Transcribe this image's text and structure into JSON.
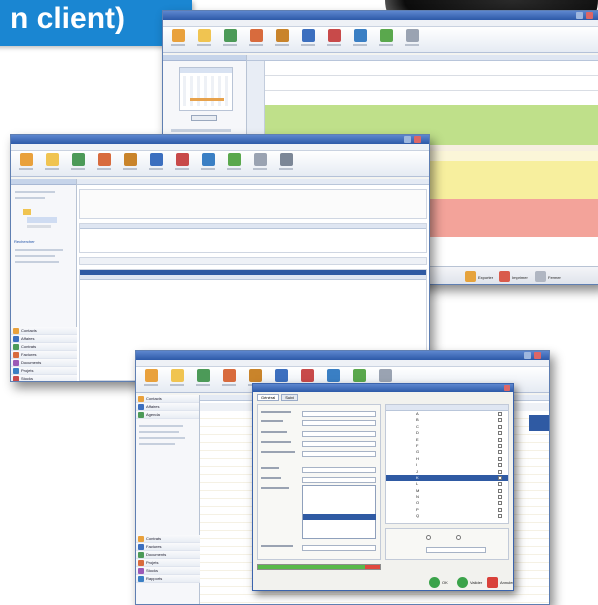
{
  "banner": {
    "title": "n client)"
  },
  "colors": {
    "banner_blue": "#1a86d2",
    "title_bar": "#2d5aa8",
    "green_band": "#bfe08a",
    "yellow_band": "#f7ef9e",
    "red_band": "#f3a39a",
    "progress_green": "#58b94a",
    "progress_red": "#e0483e"
  },
  "back_window": {
    "icons": [
      "calendar-icon",
      "folder-icon",
      "people-icon",
      "user-icon",
      "chart-icon",
      "pen-icon",
      "car-icon",
      "tools-icon",
      "upload-icon",
      "document-icon"
    ],
    "footer_buttons": [
      "Exporter",
      "Imprimer",
      "Fermer"
    ]
  },
  "middle_window": {
    "left_labels": [
      "Rechercher",
      "Contacts",
      "Ventes",
      "Agenda"
    ],
    "nav_items": [
      "Contacts",
      "Affaires",
      "Contrats",
      "Factures",
      "Documents",
      "Projets",
      "Stocks",
      "Rapports"
    ],
    "icons": [
      "calendar-icon",
      "folder-icon",
      "people-icon",
      "user-icon",
      "chart-icon",
      "pen-icon",
      "car-icon",
      "tools-icon",
      "upload-icon",
      "document-icon",
      "gear-icon"
    ]
  },
  "front_window": {
    "icons": [
      "calendar-icon",
      "folder-icon",
      "people-icon",
      "user-icon",
      "chart-icon",
      "pen-icon",
      "car-icon",
      "tools-icon",
      "upload-icon",
      "document-icon"
    ],
    "nav_items": [
      "Contacts",
      "Affaires",
      "Agenda",
      "Contrats",
      "Factures",
      "Documents",
      "Projets",
      "Stocks",
      "Rapports"
    ],
    "dialog": {
      "tabs": [
        "Général",
        "Suivi"
      ],
      "list_items": [
        "A",
        "B",
        "C",
        "D",
        "E",
        "F",
        "G",
        "H",
        "I",
        "J",
        "K",
        "L",
        "M",
        "N",
        "O",
        "P",
        "Q"
      ],
      "buttons": [
        "OK",
        "Valider",
        "Annuler"
      ]
    }
  }
}
